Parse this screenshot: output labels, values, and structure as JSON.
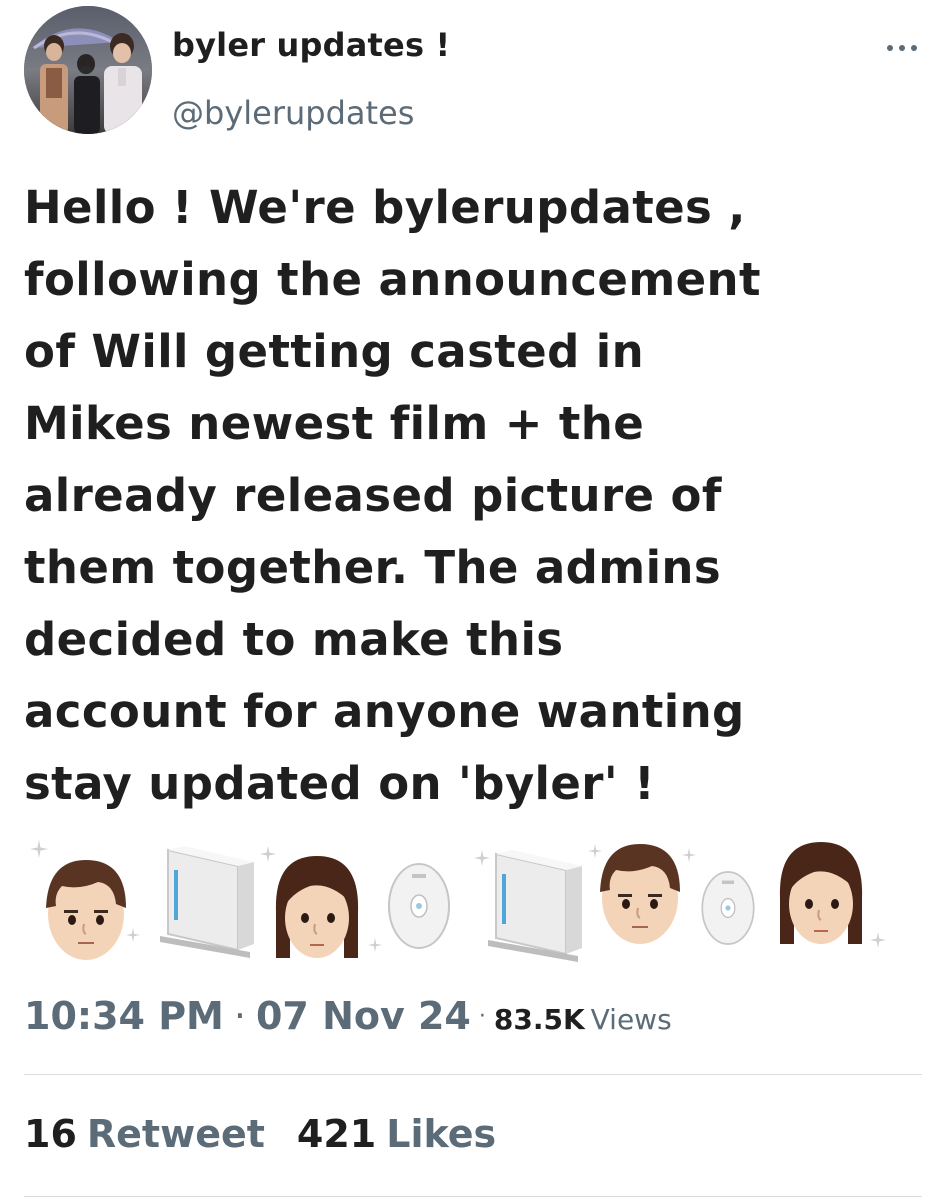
{
  "author": {
    "display_name": "byler updates !",
    "handle": "@bylerupdates",
    "avatar_icon": "profile-photo"
  },
  "tweet": {
    "text": "Hello ! We're bylerupdates ,\nfollowing the announcement\nof Will getting casted in\nMikes newest film + the\nalready released picture of\nthem together. The admins\ndecided to make this\naccount for anyone wanting\nstay updated on 'byler' !",
    "emoji_sequence": [
      "boy-mii",
      "wii-console",
      "girl-mii",
      "wii-disc",
      "wii-console",
      "boy-mii",
      "wii-disc",
      "girl-mii"
    ]
  },
  "meta": {
    "time": "10:34 PM",
    "separator": "·",
    "date": "07 Nov 24",
    "views_count": "83.5K",
    "views_label": "Views"
  },
  "stats": {
    "retweets_count": "16",
    "retweets_label": "Retweet",
    "likes_count": "421",
    "likes_label": "Likes"
  },
  "colors": {
    "text_primary": "#1f1f1f",
    "text_secondary": "#5b6b78",
    "divider": "#d7dde1"
  }
}
